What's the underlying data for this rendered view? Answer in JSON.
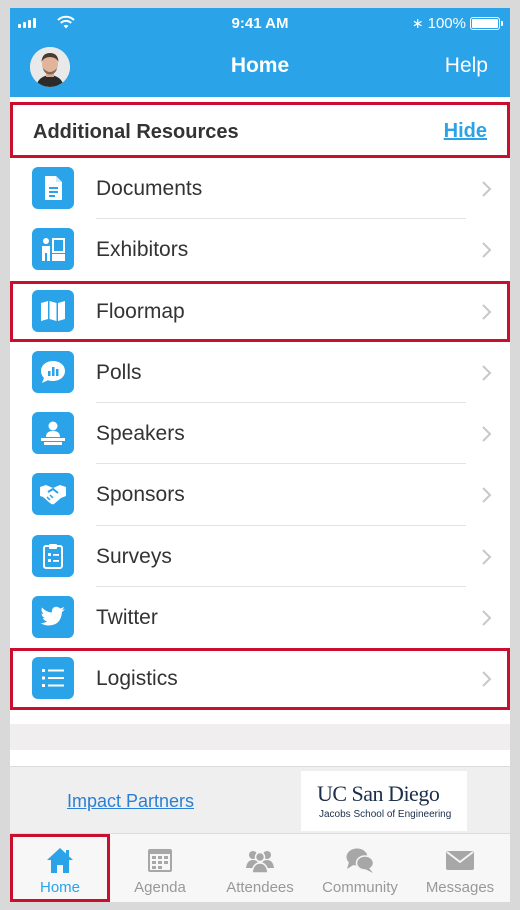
{
  "status_bar": {
    "time": "9:41 AM",
    "battery": "100%",
    "bluetooth_symbol": "∗"
  },
  "nav": {
    "title": "Home",
    "help": "Help"
  },
  "resources": {
    "title": "Additional Resources",
    "hide": "Hide"
  },
  "items": [
    {
      "label": "Documents",
      "icon": "document-icon"
    },
    {
      "label": "Exhibitors",
      "icon": "exhibitor-icon"
    },
    {
      "label": "Floormap",
      "icon": "map-icon"
    },
    {
      "label": "Polls",
      "icon": "poll-chat-icon"
    },
    {
      "label": "Speakers",
      "icon": "speaker-podium-icon"
    },
    {
      "label": "Sponsors",
      "icon": "handshake-icon"
    },
    {
      "label": "Surveys",
      "icon": "clipboard-icon"
    },
    {
      "label": "Twitter",
      "icon": "twitter-bird-icon"
    },
    {
      "label": "Logistics",
      "icon": "list-icon"
    }
  ],
  "partners": {
    "link": "Impact Partners",
    "logo_main": "UC San Diego",
    "logo_sub": "Jacobs School of Engineering"
  },
  "tabs": [
    {
      "label": "Home",
      "icon": "home-icon"
    },
    {
      "label": "Agenda",
      "icon": "calendar-icon"
    },
    {
      "label": "Attendees",
      "icon": "people-icon"
    },
    {
      "label": "Community",
      "icon": "chat-bubbles-icon"
    },
    {
      "label": "Messages",
      "icon": "envelope-icon"
    }
  ],
  "colors": {
    "accent": "#2aa3e8",
    "highlight": "#c8102e",
    "link": "#2a7fd4"
  }
}
